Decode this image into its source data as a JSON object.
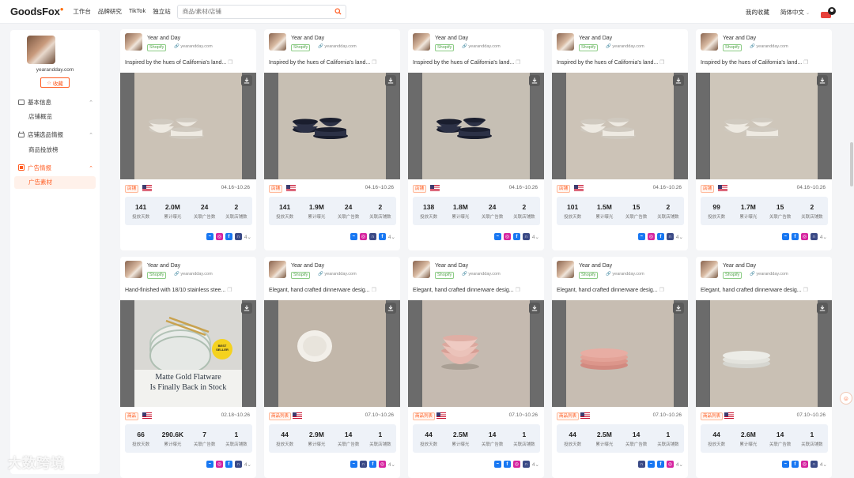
{
  "brand": {
    "name": "GoodsFox",
    "accent": "#ff5a1f"
  },
  "nav": [
    "工作台",
    "品牌研究",
    "TikTok",
    "独立站"
  ],
  "search": {
    "placeholder": "商品/素材/店铺"
  },
  "topright": {
    "favorites": "我的收藏",
    "language": "简体中文",
    "vip": "VIP"
  },
  "sidebar": {
    "shop_name": "yearandday.com",
    "fav_label": "收藏",
    "groups": [
      {
        "label": "基本信息",
        "items": [
          "店铺概览"
        ]
      },
      {
        "label": "店铺选品情报",
        "items": [
          "商品投放榜"
        ]
      },
      {
        "label": "广告情报",
        "items": [
          "广告素材"
        ]
      }
    ]
  },
  "stat_labels": [
    "投放天数",
    "累计曝光",
    "关联广告数",
    "关联店铺数"
  ],
  "cards": [
    {
      "name": "Year and Day",
      "tag": "Shopify",
      "link": "yearandday.com",
      "desc": "Inspired by the hues of California's land...",
      "badge": "店铺",
      "date": "04.16~10.26",
      "stats": [
        "141",
        "2.0M",
        "24",
        "2"
      ],
      "platforms": [
        "messenger-icon",
        "instagram-icon",
        "facebook-icon",
        "audience-network-icon"
      ],
      "more": "4"
    },
    {
      "name": "Year and Day",
      "tag": "Shopify",
      "link": "yearandday.com",
      "desc": "Inspired by the hues of California's land...",
      "badge": "店铺",
      "date": "04.16~10.26",
      "stats": [
        "141",
        "1.9M",
        "24",
        "2"
      ],
      "platforms": [
        "messenger-icon",
        "instagram-icon",
        "audience-network-icon",
        "facebook-icon"
      ],
      "more": "4"
    },
    {
      "name": "Year and Day",
      "tag": "Shopify",
      "link": "yearandday.com",
      "desc": "Inspired by the hues of California's land...",
      "badge": "店铺",
      "date": "04.16~10.26",
      "stats": [
        "138",
        "1.8M",
        "24",
        "2"
      ],
      "platforms": [
        "messenger-icon",
        "instagram-icon",
        "facebook-icon",
        "audience-network-icon"
      ],
      "more": "4"
    },
    {
      "name": "Year and Day",
      "tag": "Shopify",
      "link": "yearandday.com",
      "desc": "Inspired by the hues of California's land...",
      "badge": "店铺",
      "date": "04.16~10.26",
      "stats": [
        "101",
        "1.5M",
        "15",
        "2"
      ],
      "platforms": [
        "messenger-icon",
        "instagram-icon",
        "facebook-icon",
        "audience-network-icon"
      ],
      "more": "4"
    },
    {
      "name": "Year and Day",
      "tag": "Shopify",
      "link": "yearandday.com",
      "desc": "Inspired by the hues of California's land...",
      "badge": "店铺",
      "date": "04.16~10.26",
      "stats": [
        "99",
        "1.7M",
        "15",
        "2"
      ],
      "platforms": [
        "messenger-icon",
        "facebook-icon",
        "instagram-icon",
        "audience-network-icon"
      ],
      "more": "4"
    },
    {
      "name": "Year and Day",
      "tag": "Shopify",
      "link": "yearandday.com",
      "desc": "Hand-finished with 18/10 stainless stee...",
      "badge": "商品",
      "date": "02.18~10.26",
      "stats": [
        "66",
        "290.6K",
        "7",
        "1"
      ],
      "platforms": [
        "messenger-icon",
        "instagram-icon",
        "facebook-icon",
        "audience-network-icon"
      ],
      "more": "4",
      "overlay": [
        "Matte Gold Flatware",
        "Is Finally Back in Stock"
      ],
      "seal": [
        "BEST",
        "SELLER"
      ]
    },
    {
      "name": "Year and Day",
      "tag": "Shopify",
      "link": "yearandday.com",
      "desc": "Elegant, hand crafted dinnerware desig...",
      "badge": "商品列表",
      "date": "07.10~10.26",
      "stats": [
        "44",
        "2.9M",
        "14",
        "1"
      ],
      "platforms": [
        "messenger-icon",
        "audience-network-icon",
        "facebook-icon",
        "instagram-icon"
      ],
      "more": "4"
    },
    {
      "name": "Year and Day",
      "tag": "Shopify",
      "link": "yearandday.com",
      "desc": "Elegant, hand crafted dinnerware desig...",
      "badge": "商品列表",
      "date": "07.10~10.26",
      "stats": [
        "44",
        "2.5M",
        "14",
        "1"
      ],
      "platforms": [
        "messenger-icon",
        "facebook-icon",
        "instagram-icon",
        "audience-network-icon"
      ],
      "more": "4"
    },
    {
      "name": "Year and Day",
      "tag": "Shopify",
      "link": "yearandday.com",
      "desc": "Elegant, hand crafted dinnerware desig...",
      "badge": "商品列表",
      "date": "07.10~10.26",
      "stats": [
        "44",
        "2.5M",
        "14",
        "1"
      ],
      "platforms": [
        "audience-network-icon",
        "messenger-icon",
        "facebook-icon",
        "instagram-icon"
      ],
      "more": "4"
    },
    {
      "name": "Year and Day",
      "tag": "Shopify",
      "link": "yearandday.com",
      "desc": "Elegant, hand crafted dinnerware desig...",
      "badge": "商品列表",
      "date": "07.10~10.26",
      "stats": [
        "44",
        "2.6M",
        "14",
        "1"
      ],
      "platforms": [
        "messenger-icon",
        "facebook-icon",
        "instagram-icon",
        "audience-network-icon"
      ],
      "more": "4"
    }
  ],
  "watermark": "大数跨境"
}
